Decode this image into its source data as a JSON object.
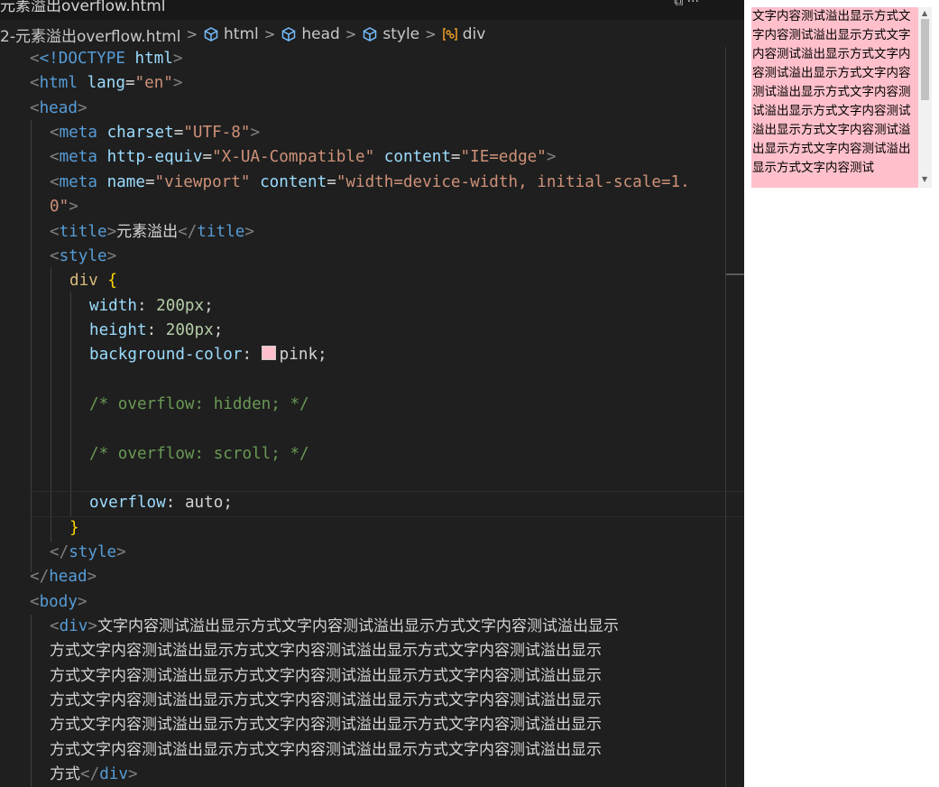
{
  "tab": {
    "title": "元素溢出overflow.html",
    "actions": "⧉ ···"
  },
  "breadcrumb": [
    "2-元素溢出overflow.html",
    "html",
    "head",
    "style",
    "div"
  ],
  "code": {
    "l1_doctype": "<!DOCTYPE",
    "l1_html": "html",
    "l2_tag": "html",
    "l2_attr": "lang",
    "l2_val": "\"en\"",
    "l3_tag": "head",
    "l4_tag": "meta",
    "l4_attr": "charset",
    "l4_val": "\"UTF-8\"",
    "l5_attr1": "http-equiv",
    "l5_val1": "\"X-UA-Compatible\"",
    "l5_attr2": "content",
    "l5_val2": "\"IE=edge\"",
    "l6_attr1": "name",
    "l6_val1": "\"viewport\"",
    "l6_attr2": "content",
    "l6_val2a": "\"width=device-width, initial-scale=1.",
    "l6_val2b": "0\"",
    "title_tag": "title",
    "title_text": "元素溢出",
    "style_tag": "style",
    "selector": "div",
    "width_prop": "width",
    "width_val": "200px",
    "height_prop": "height",
    "height_val": "200px",
    "bg_prop": "background-color",
    "bg_val": "pink",
    "comment1": "/* overflow: hidden; */",
    "comment2": "/* overflow: scroll; */",
    "overflow_prop": "overflow",
    "overflow_val": "auto",
    "body_tag": "body",
    "div_tag": "div",
    "body_lines": [
      "文字内容测试溢出显示方式文字内容测试溢出显示方式文字内容测试溢出显示",
      "方式文字内容测试溢出显示方式文字内容测试溢出显示方式文字内容测试溢出显示",
      "方式文字内容测试溢出显示方式文字内容测试溢出显示方式文字内容测试溢出显示",
      "方式文字内容测试溢出显示方式文字内容测试溢出显示方式文字内容测试溢出显示",
      "方式文字内容测试溢出显示方式文字内容测试溢出显示方式文字内容测试溢出显示",
      "方式文字内容测试溢出显示方式文字内容测试溢出显示方式文字内容测试溢出显示",
      "方式"
    ]
  },
  "preview": {
    "text": "文字内容测试溢出显示方式文字内容测试溢出显示方式文字内容测试溢出显示方式文字内容测试溢出显示方式文字内容测试溢出显示方式文字内容测试溢出显示方式文字内容测试溢出显示方式文字内容测试溢出显示方式文字内容测试溢出显示方式文字内容测试",
    "bg_color": "#ffc0cb"
  }
}
